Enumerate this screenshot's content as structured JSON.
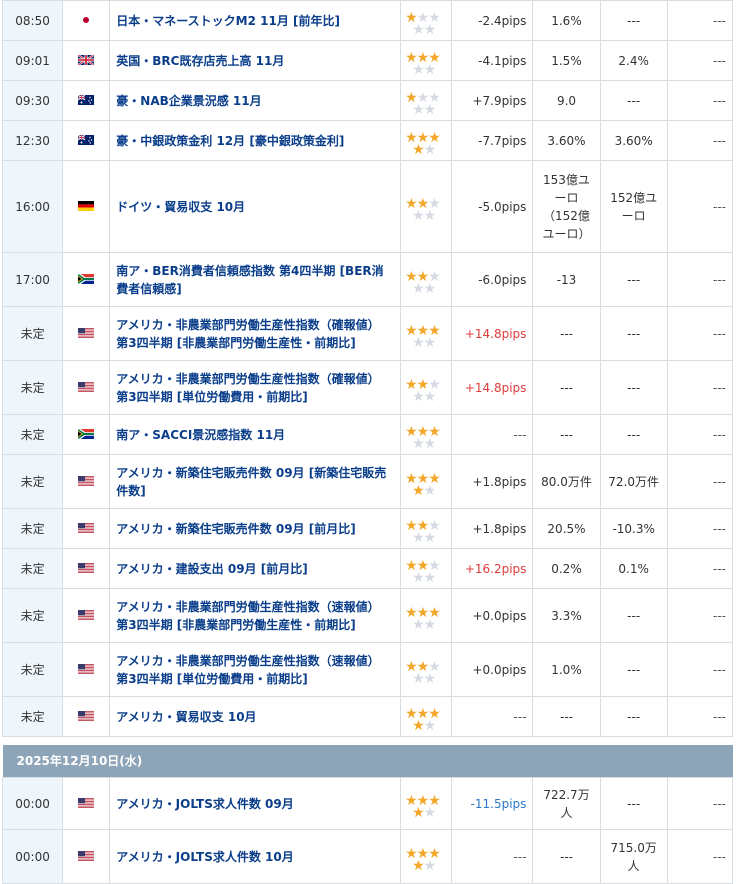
{
  "rows": [
    {
      "time": "08:50",
      "flag": "jp",
      "event": "日本・マネーストックM2 11月 [前年比]",
      "stars": 1,
      "pips": "-2.4pips",
      "pips_class": "neu",
      "result": "1.6%",
      "forecast": "---",
      "prev": "---"
    },
    {
      "time": "09:01",
      "flag": "gb",
      "event": "英国・BRC既存店売上高 11月",
      "stars": 3,
      "pips": "-4.1pips",
      "pips_class": "neu",
      "result": "1.5%",
      "forecast": "2.4%",
      "prev": "---"
    },
    {
      "time": "09:30",
      "flag": "au",
      "event": "豪・NAB企業景況感 11月",
      "stars": 1,
      "pips": "+7.9pips",
      "pips_class": "neu",
      "result": "9.0",
      "forecast": "---",
      "prev": "---"
    },
    {
      "time": "12:30",
      "flag": "au",
      "event": "豪・中銀政策金利 12月 [豪中銀政策金利]",
      "stars": 4,
      "pips": "-7.7pips",
      "pips_class": "neu",
      "result": "3.60%",
      "forecast": "3.60%",
      "prev": "---"
    },
    {
      "time": "16:00",
      "flag": "de",
      "event": "ドイツ・貿易収支 10月",
      "stars": 2,
      "pips": "-5.0pips",
      "pips_class": "neu",
      "result": "153億ユーロ（152億ユーロ）",
      "forecast": "152億ユーロ",
      "prev": "---"
    },
    {
      "time": "17:00",
      "flag": "za",
      "event": "南ア・BER消費者信頼感指数 第4四半期 [BER消費者信頼感]",
      "stars": 2,
      "pips": "-6.0pips",
      "pips_class": "neu",
      "result": "-13",
      "forecast": "---",
      "prev": "---"
    },
    {
      "time": "未定",
      "flag": "us",
      "event": "アメリカ・非農業部門労働生産性指数（確報値） 第3四半期 [非農業部門労働生産性・前期比]",
      "stars": 3,
      "pips": "+14.8pips",
      "pips_class": "pos",
      "result": "---",
      "forecast": "---",
      "prev": "---"
    },
    {
      "time": "未定",
      "flag": "us",
      "event": "アメリカ・非農業部門労働生産性指数（確報値） 第3四半期 [単位労働費用・前期比]",
      "stars": 2,
      "pips": "+14.8pips",
      "pips_class": "pos",
      "result": "---",
      "forecast": "---",
      "prev": "---"
    },
    {
      "time": "未定",
      "flag": "za",
      "event": "南ア・SACCI景況感指数 11月",
      "stars": 3,
      "pips": "---",
      "pips_class": "dash",
      "result": "---",
      "forecast": "---",
      "prev": "---"
    },
    {
      "time": "未定",
      "flag": "us",
      "event": "アメリカ・新築住宅販売件数 09月 [新築住宅販売件数]",
      "stars": 4,
      "pips": "+1.8pips",
      "pips_class": "neu",
      "result": "80.0万件",
      "forecast": "72.0万件",
      "prev": "---"
    },
    {
      "time": "未定",
      "flag": "us",
      "event": "アメリカ・新築住宅販売件数 09月 [前月比]",
      "stars": 2,
      "pips": "+1.8pips",
      "pips_class": "neu",
      "result": "20.5%",
      "forecast": "-10.3%",
      "prev": "---"
    },
    {
      "time": "未定",
      "flag": "us",
      "event": "アメリカ・建設支出 09月 [前月比]",
      "stars": 2,
      "pips": "+16.2pips",
      "pips_class": "pos",
      "result": "0.2%",
      "forecast": "0.1%",
      "prev": "---"
    },
    {
      "time": "未定",
      "flag": "us",
      "event": "アメリカ・非農業部門労働生産性指数（速報値） 第3四半期 [非農業部門労働生産性・前期比]",
      "stars": 3,
      "pips": "+0.0pips",
      "pips_class": "neu",
      "result": "3.3%",
      "forecast": "---",
      "prev": "---"
    },
    {
      "time": "未定",
      "flag": "us",
      "event": "アメリカ・非農業部門労働生産性指数（速報値） 第3四半期 [単位労働費用・前期比]",
      "stars": 2,
      "pips": "+0.0pips",
      "pips_class": "neu",
      "result": "1.0%",
      "forecast": "---",
      "prev": "---"
    },
    {
      "time": "未定",
      "flag": "us",
      "event": "アメリカ・貿易収支 10月",
      "stars": 4,
      "pips": "---",
      "pips_class": "dash",
      "result": "---",
      "forecast": "---",
      "prev": "---"
    }
  ],
  "date_header": "2025年12月10日(水)",
  "rows2": [
    {
      "time": "00:00",
      "flag": "us",
      "event": "アメリカ・JOLTS求人件数 09月",
      "stars": 4,
      "pips": "-11.5pips",
      "pips_class": "neg",
      "result": "722.7万人",
      "forecast": "---",
      "prev": "---"
    },
    {
      "time": "00:00",
      "flag": "us",
      "event": "アメリカ・JOLTS求人件数 10月",
      "stars": 4,
      "pips": "---",
      "pips_class": "dash",
      "result": "---",
      "forecast": "715.0万人",
      "prev": "---"
    }
  ],
  "colors": {
    "star_on": "#f3a72a",
    "pips_up": "#e03c3c",
    "pips_down": "#2a78c8",
    "date_bar": "#8ea4b8",
    "event_text": "#0b3e8a"
  }
}
